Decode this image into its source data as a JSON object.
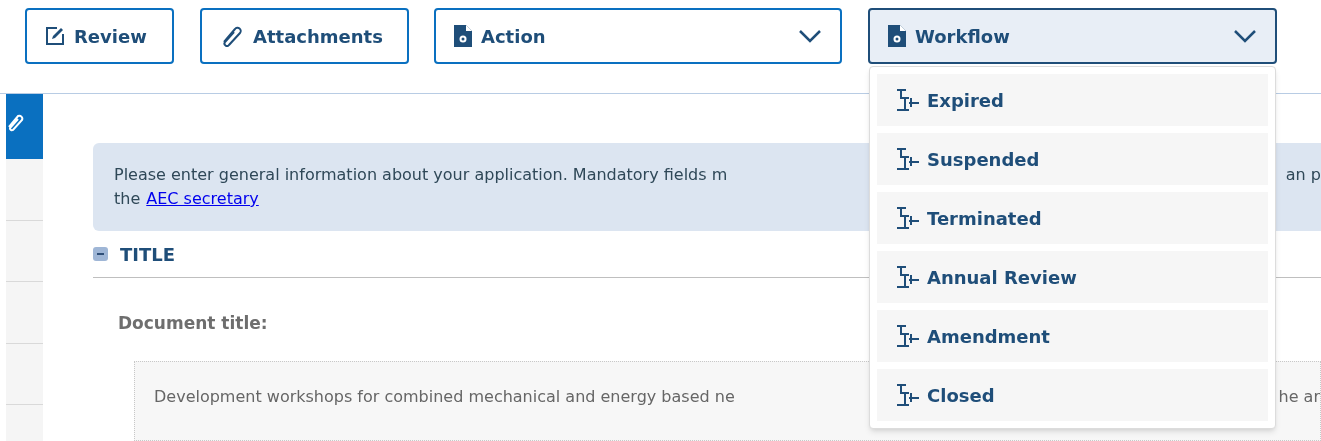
{
  "toolbar": [
    {
      "kind": "plain",
      "label": "Review"
    },
    {
      "kind": "plain",
      "label": "Attachments"
    },
    {
      "kind": "dropdown",
      "label": "Action",
      "expanded": false
    },
    {
      "kind": "dropdown",
      "label": "Workflow",
      "expanded": true
    }
  ],
  "workflow_menu": [
    "Expired",
    "Suspended",
    "Terminated",
    "Annual Review",
    "Amendment",
    "Closed"
  ],
  "info": {
    "line_1": "Please enter general information about your application. Mandatory fields m",
    "line_1_right": "an p",
    "line_2_start": "the",
    "link": "AEC secretary"
  },
  "section": {
    "title": "TITLE",
    "expanded": true
  },
  "field": {
    "label": "Document title:",
    "value": "Development workshops for combined mechanical and energy based ne",
    "value_right": "he ar"
  }
}
